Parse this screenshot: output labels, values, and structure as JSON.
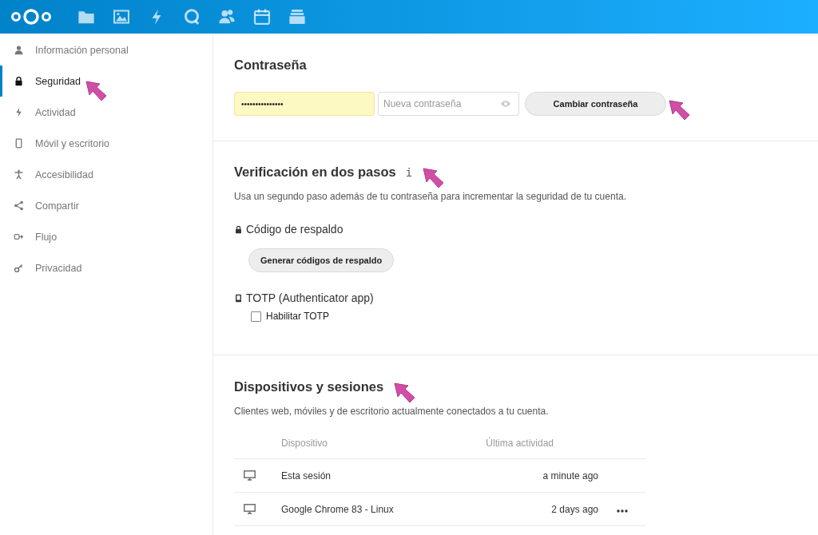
{
  "sidebar": {
    "items": [
      {
        "label": "Información personal",
        "kind": "person",
        "selected": false
      },
      {
        "label": "Seguridad",
        "kind": "lock",
        "selected": true
      },
      {
        "label": "Actividad",
        "kind": "bolt",
        "selected": false
      },
      {
        "label": "Móvil y escritorio",
        "kind": "phone",
        "selected": false
      },
      {
        "label": "Accesibilidad",
        "kind": "accessibility",
        "selected": false
      },
      {
        "label": "Compartir",
        "kind": "share",
        "selected": false
      },
      {
        "label": "Flujo",
        "kind": "flow",
        "selected": false
      },
      {
        "label": "Privacidad",
        "kind": "key",
        "selected": false
      }
    ]
  },
  "password": {
    "title": "Contraseña",
    "current_value": "•••••••••••••••",
    "new_placeholder": "Nueva contraseña",
    "button": "Cambiar contraseña"
  },
  "two_factor": {
    "title": "Verificación en dos pasos",
    "info_glyph": "i",
    "description": "Usa un segundo paso además de tu contraseña para incrementar la seguridad de tu cuenta.",
    "backup": {
      "title": "Código de respaldo",
      "button": "Generar códigos de respaldo"
    },
    "totp": {
      "title": "TOTP (Authenticator app)",
      "checkbox_label": "Habilitar TOTP",
      "checked": false
    }
  },
  "devices": {
    "title": "Dispositivos y sesiones",
    "description": "Clientes web, móviles y de escritorio actualmente conectados a tu cuenta.",
    "columns": [
      "Dispositivo",
      "Última actividad"
    ],
    "rows": [
      {
        "device": "Esta sesión",
        "last_activity": "a minute ago",
        "has_menu": false
      },
      {
        "device": "Google Chrome 83 - Linux",
        "last_activity": "2 days ago",
        "has_menu": true
      }
    ]
  }
}
